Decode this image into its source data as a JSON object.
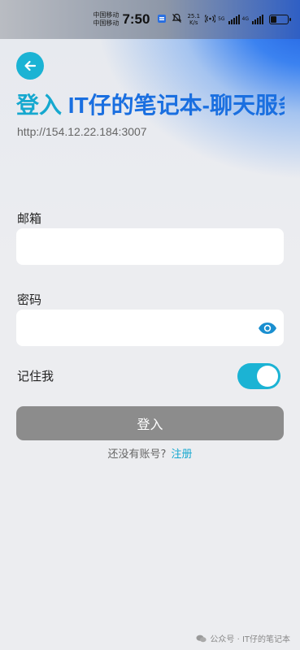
{
  "status_bar": {
    "carrier_1": "中国移动",
    "carrier_2": "中国移动",
    "time": "7:50",
    "net_speed_value": "25.1",
    "net_speed_unit": "K/s",
    "net_1": "5G",
    "net_2": "4G"
  },
  "header": {
    "title_prefix": "登入",
    "title_name": " IT仔的笔记本-聊天服务器",
    "server_url": "http://154.12.22.184:3007"
  },
  "form": {
    "email_label": "邮箱",
    "email_value": "",
    "password_label": "密码",
    "password_value": "",
    "remember_label": "记住我",
    "remember_on": true,
    "login_button": "登入",
    "no_account_text": "还没有账号?",
    "register_link": "注册"
  },
  "watermark": {
    "text": "公众号 · IT仔的笔记本"
  },
  "colors": {
    "accent": "#1bb3d4",
    "title_blue": "#1a6fe0",
    "button_gray": "#8c8c8c"
  }
}
